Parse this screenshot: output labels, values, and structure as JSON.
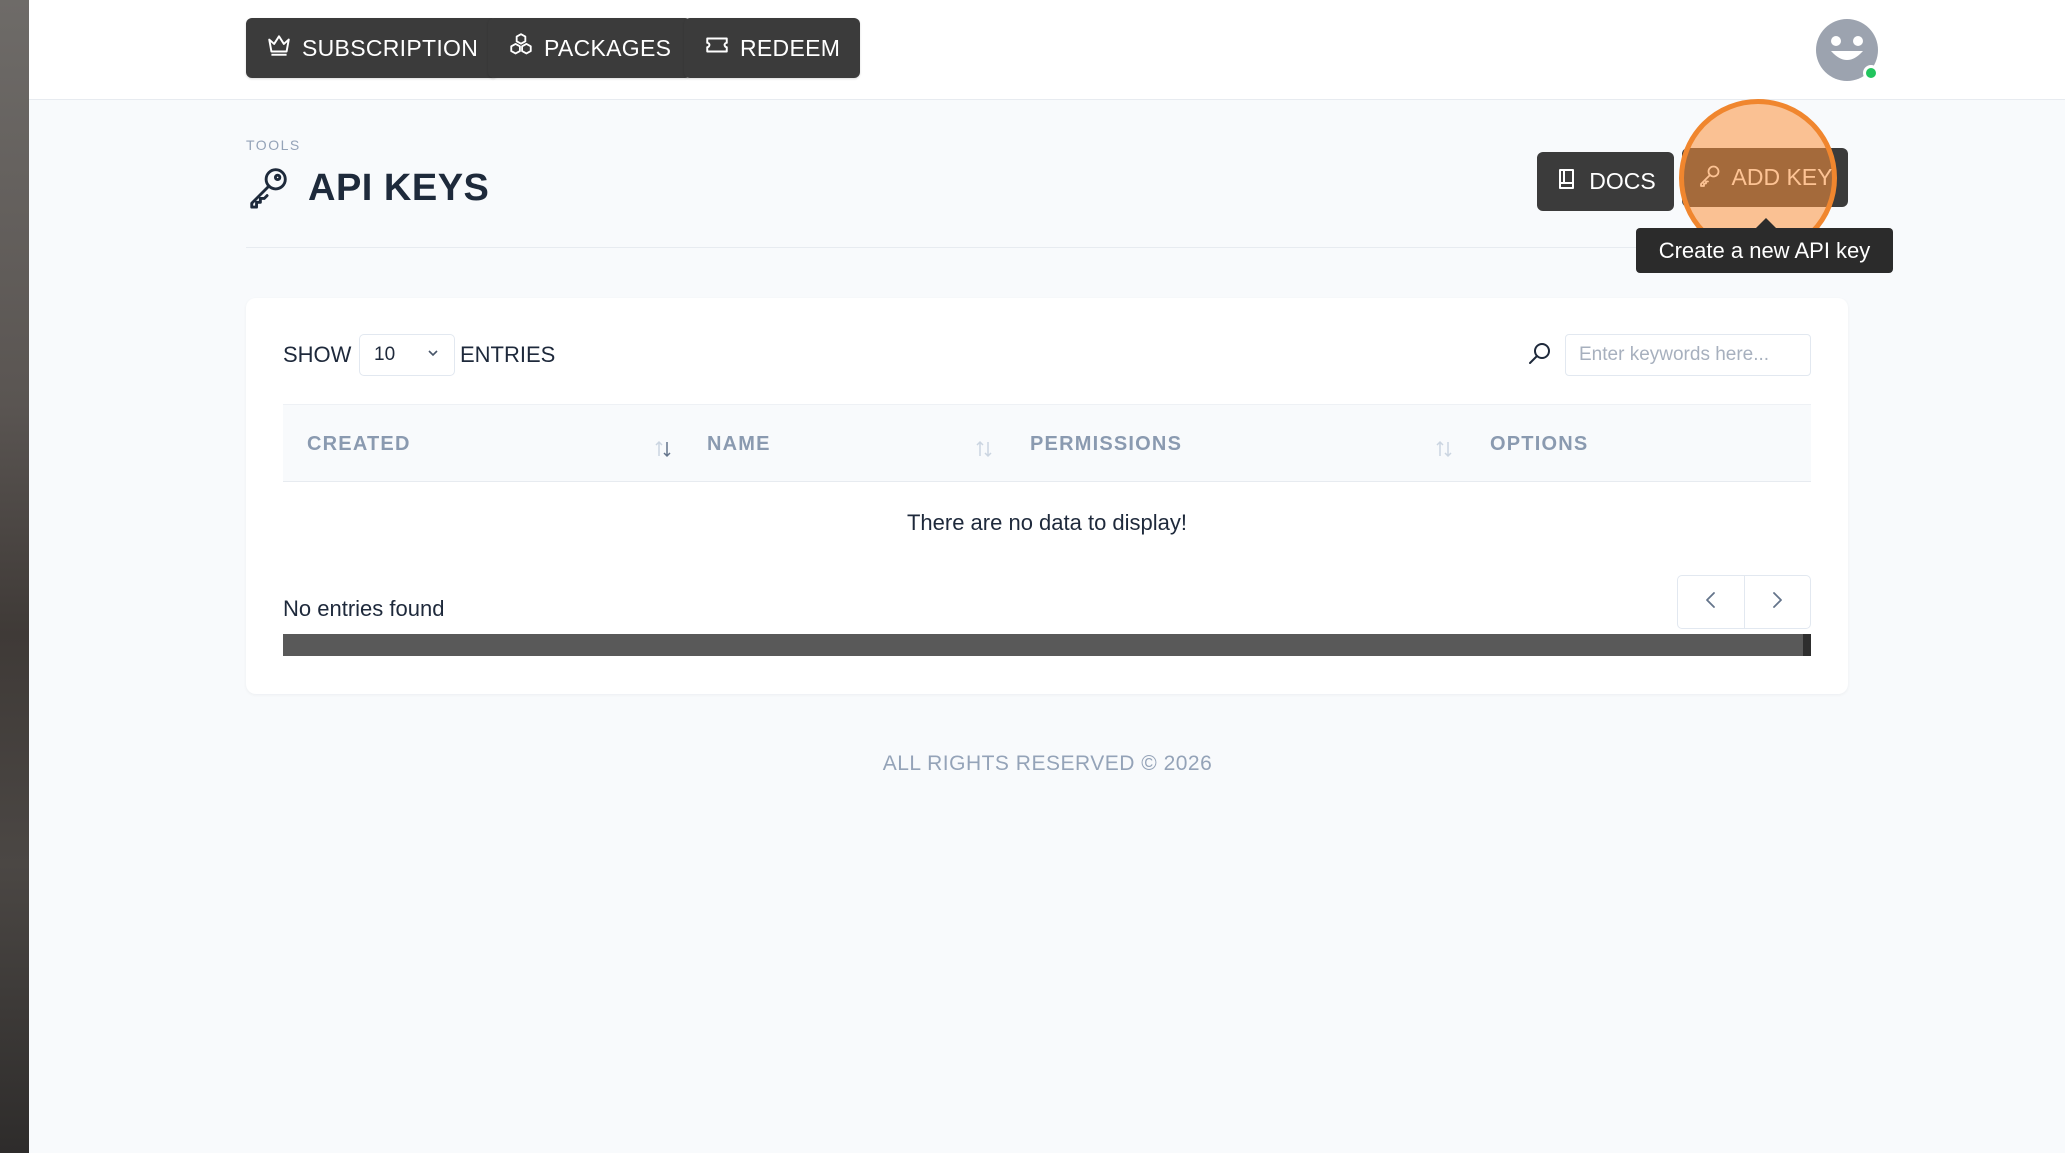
{
  "nav": {
    "subscription_label": "SUBSCRIPTION",
    "packages_label": "PACKAGES",
    "redeem_label": "REDEEM"
  },
  "header": {
    "eyebrow": "TOOLS",
    "title": "API KEYS",
    "docs_label": "DOCS",
    "add_key_label": "ADD KEY",
    "add_key_tooltip": "Create a new API key"
  },
  "table": {
    "show_label": "SHOW",
    "page_size": "10",
    "entries_label": "ENTRIES",
    "search_placeholder": "Enter keywords here...",
    "columns": [
      "CREATED",
      "NAME",
      "PERMISSIONS",
      "OPTIONS"
    ],
    "empty_message": "There are no data to display!",
    "status_text": "No entries found"
  },
  "footer": {
    "text": "ALL RIGHTS RESERVED © 2026"
  },
  "colors": {
    "button_bg": "#3b3b3b",
    "highlight": "#f0862e",
    "online_status": "#22c55e"
  },
  "icons": [
    "crown-icon",
    "cubes-icon",
    "ticket-icon",
    "avatar-smiley-icon",
    "key-icon",
    "book-icon",
    "search-icon",
    "sort-icon",
    "chevron-left-icon",
    "chevron-right-icon"
  ]
}
